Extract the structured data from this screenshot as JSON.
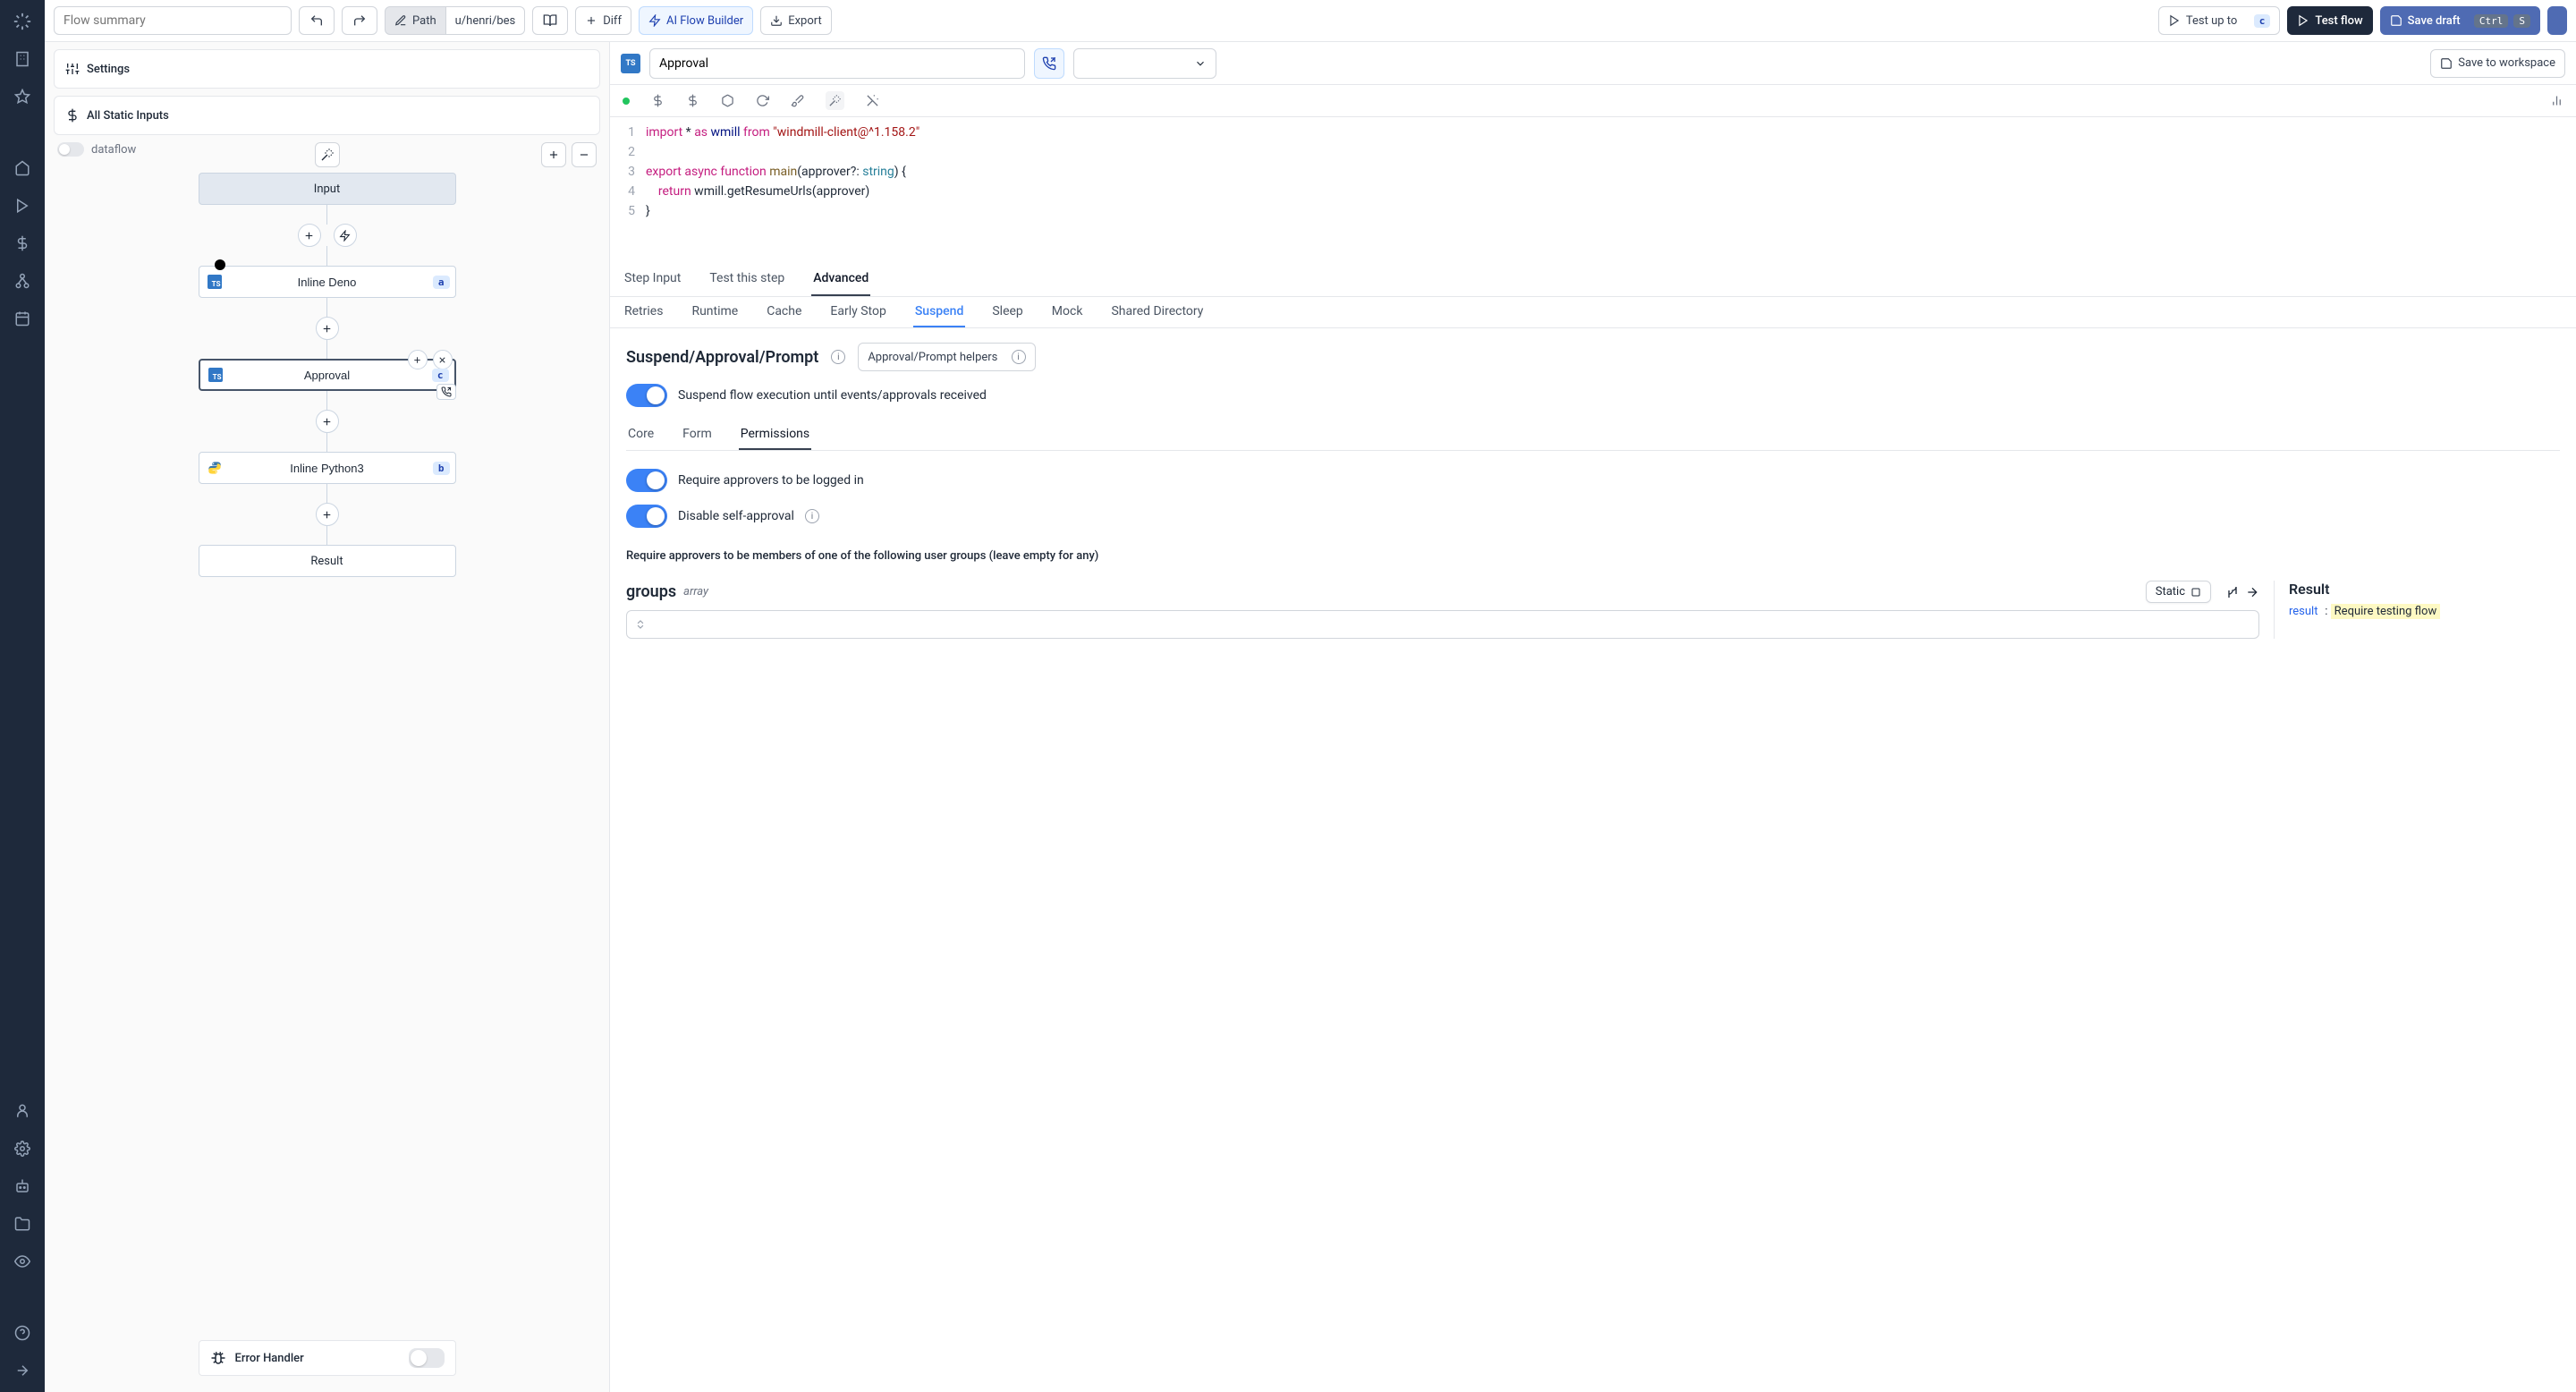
{
  "topbar": {
    "summary_placeholder": "Flow summary",
    "path_btn": "Path",
    "path_value": "u/henri/bes",
    "diff": "Diff",
    "ai": "AI Flow Builder",
    "export": "Export",
    "test_up_to": "Test up to",
    "step_badge": "c",
    "test_flow": "Test flow",
    "save_draft": "Save draft",
    "kbd_ctrl": "Ctrl",
    "kbd_s": "S"
  },
  "left": {
    "settings": "Settings",
    "all_static": "All Static Inputs",
    "dataflow": "dataflow",
    "nodes": {
      "input": "Input",
      "deno": "Inline Deno",
      "deno_tag": "a",
      "approval": "Approval",
      "approval_tag": "c",
      "python": "Inline Python3",
      "python_tag": "b",
      "result": "Result"
    },
    "error_handler": "Error Handler"
  },
  "editor": {
    "step_name": "Approval",
    "save_workspace": "Save to workspace",
    "code": {
      "l1a": "import",
      "l1b": " * ",
      "l1c": "as",
      "l1d": " wmill ",
      "l1e": "from",
      "l1f": " \"windmill-client@^1.158.2\"",
      "l3a": "export",
      "l3b": " async ",
      "l3c": "function",
      "l3d": " main",
      "l3e": "(approver?: ",
      "l3f": "string",
      "l3g": ") {",
      "l4a": "    ",
      "l4b": "return",
      "l4c": " wmill.getResumeUrls(approver)",
      "l5": "}"
    },
    "tabs": {
      "step_input": "Step Input",
      "test_step": "Test this step",
      "advanced": "Advanced"
    },
    "subtabs": {
      "retries": "Retries",
      "runtime": "Runtime",
      "cache": "Cache",
      "early_stop": "Early Stop",
      "suspend": "Suspend",
      "sleep": "Sleep",
      "mock": "Mock",
      "shared": "Shared Directory"
    }
  },
  "suspend": {
    "title": "Suspend/Approval/Prompt",
    "helpers": "Approval/Prompt helpers",
    "toggle_suspend": "Suspend flow execution until events/approvals received",
    "perm_tabs": {
      "core": "Core",
      "form": "Form",
      "permissions": "Permissions"
    },
    "toggle_login": "Require approvers to be logged in",
    "toggle_self": "Disable self-approval",
    "groups_req": "Require approvers to be members of one of the following user groups (leave empty for any)",
    "groups_label": "groups",
    "groups_type": "array",
    "static": "Static",
    "result_title": "Result",
    "result_key": "result",
    "result_val": "Require testing flow"
  }
}
